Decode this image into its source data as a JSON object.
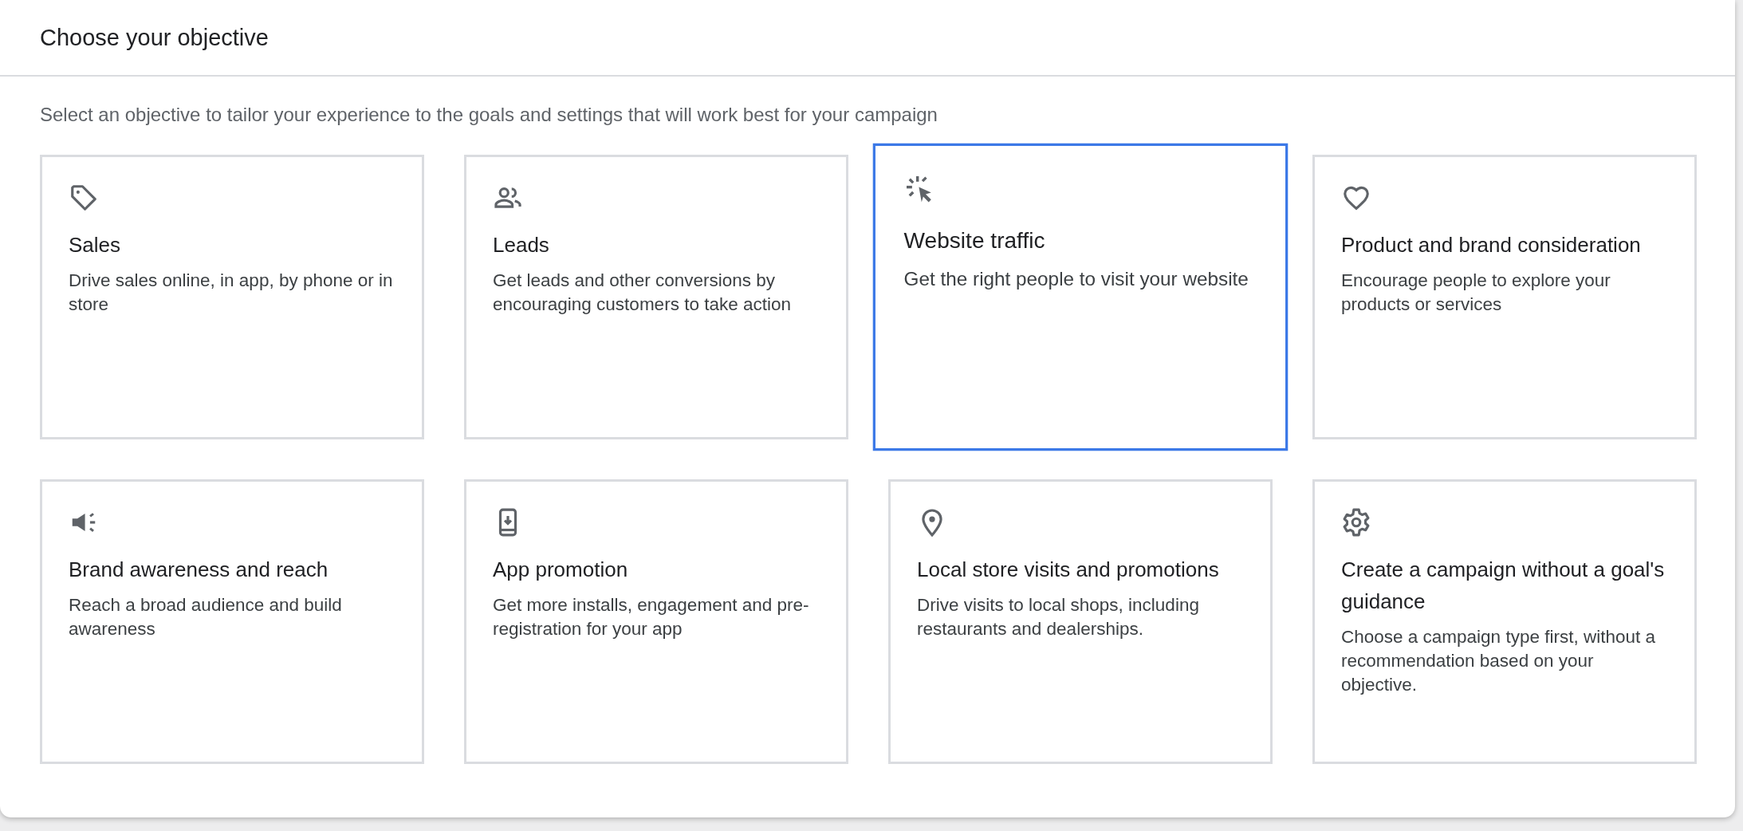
{
  "dialog": {
    "title": "Choose your objective",
    "subtitle": "Select an objective to tailor your experience to the goals and settings that will work best for your campaign"
  },
  "objectives": [
    {
      "kind": "tag",
      "title": "Sales",
      "description": "Drive sales online, in app, by phone or in store",
      "selected": false
    },
    {
      "kind": "people",
      "title": "Leads",
      "description": "Get leads and other conversions by encouraging customers to take action",
      "selected": false
    },
    {
      "kind": "click",
      "title": "Website traffic",
      "description": "Get the right people to visit your website",
      "selected": true
    },
    {
      "kind": "heart",
      "title": "Product and brand consideration",
      "description": "Encourage people to explore your products or services",
      "selected": false
    },
    {
      "kind": "megaphone",
      "title": "Brand awareness and reach",
      "description": "Reach a broad audience and build awareness",
      "selected": false
    },
    {
      "kind": "phone",
      "title": "App promotion",
      "description": "Get more installs, engagement and pre-registration for your app",
      "selected": false
    },
    {
      "kind": "pin",
      "title": "Local store visits and promotions",
      "description": "Drive visits to local shops, including restaurants and dealerships.",
      "selected": false
    },
    {
      "kind": "gear",
      "title": "Create a campaign without a goal's guidance",
      "description": "Choose a campaign type first, without a recommendation based on your objective.",
      "selected": false
    }
  ]
}
